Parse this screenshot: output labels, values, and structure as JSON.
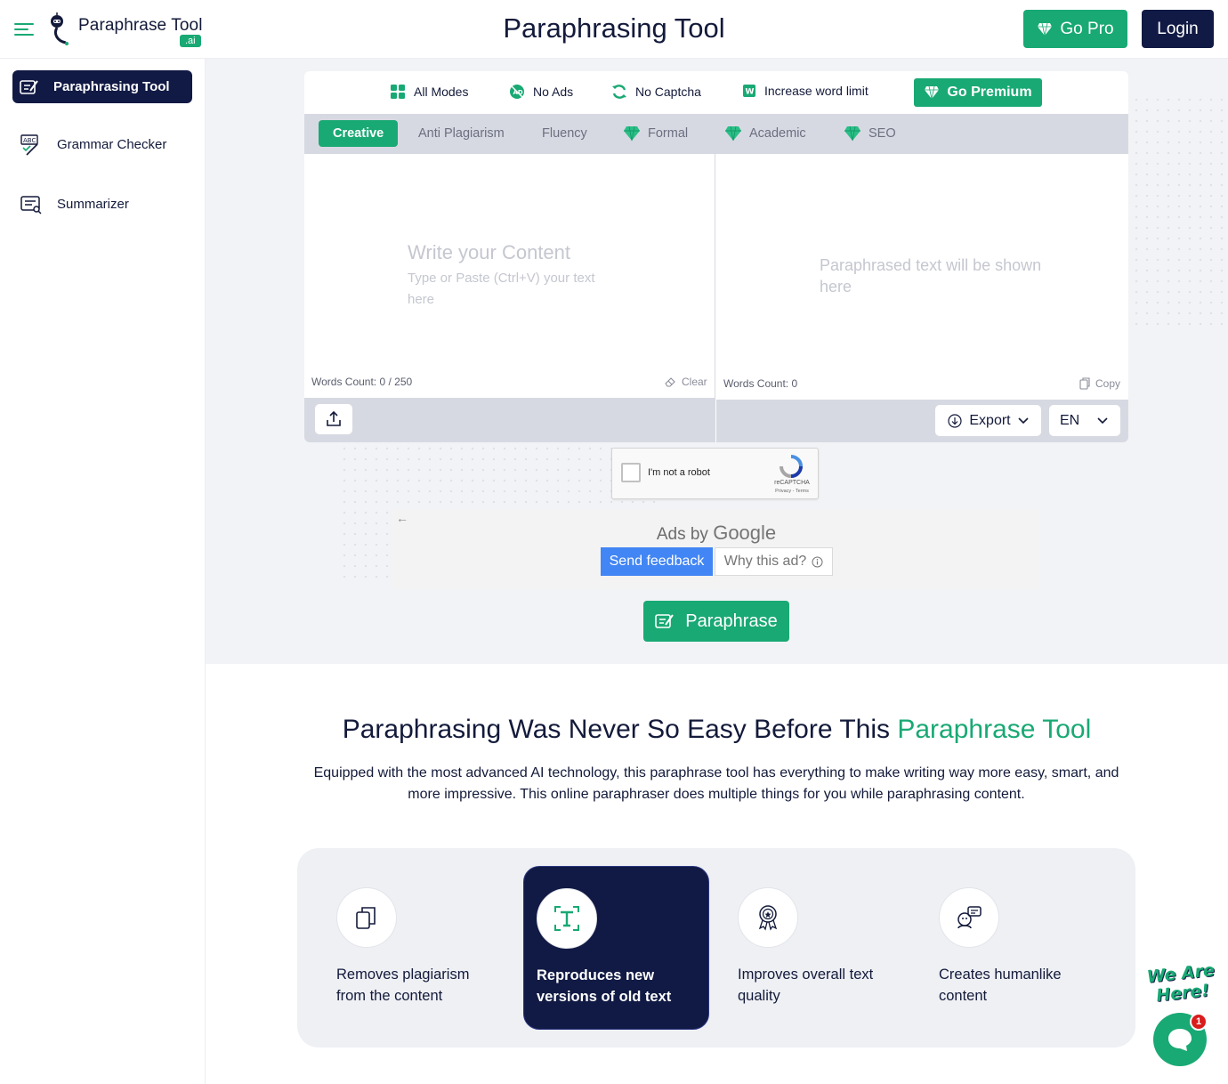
{
  "header": {
    "logo_text": "Paraphrase Tool",
    "logo_badge": ".ai",
    "title": "Paraphrasing Tool",
    "go_pro_label": "Go Pro",
    "login_label": "Login"
  },
  "sidebar": {
    "items": [
      {
        "label": "Paraphrasing Tool",
        "icon": "paraphrase-icon",
        "active": true
      },
      {
        "label": "Grammar Checker",
        "icon": "grammar-icon",
        "active": false
      },
      {
        "label": "Summarizer",
        "icon": "summarizer-icon",
        "active": false
      }
    ]
  },
  "features": {
    "items": [
      "All Modes",
      "No Ads",
      "No Captcha",
      "Increase word limit"
    ],
    "premium_label": "Go Premium"
  },
  "modes": {
    "items": [
      {
        "label": "Creative",
        "active": true,
        "premium": false
      },
      {
        "label": "Anti Plagiarism",
        "active": false,
        "premium": false
      },
      {
        "label": "Fluency",
        "active": false,
        "premium": false
      },
      {
        "label": "Formal",
        "active": false,
        "premium": true
      },
      {
        "label": "Academic",
        "active": false,
        "premium": true
      },
      {
        "label": "SEO",
        "active": false,
        "premium": true
      }
    ]
  },
  "input_pane": {
    "placeholder_title": "Write your Content",
    "placeholder_sub": "Type or Paste (Ctrl+V) your text here",
    "words_count": "Words Count: 0 / 250",
    "clear_label": "Clear"
  },
  "output_pane": {
    "placeholder": "Paraphrased text will be shown here",
    "words_count": "Words Count: 0",
    "copy_label": "Copy",
    "export_label": "Export",
    "language": "EN"
  },
  "captcha": {
    "label": "I'm not a robot",
    "brand": "reCAPTCHA",
    "terms": "Privacy - Terms"
  },
  "ads": {
    "title_prefix": "Ads by",
    "title_brand": "Google",
    "feedback_label": "Send feedback",
    "why_label": "Why this ad?"
  },
  "paraphrase_button": "Paraphrase",
  "section": {
    "title_main": "Paraphrasing Was Never So Easy Before This ",
    "title_highlight": "Paraphrase Tool",
    "description": "Equipped with the most advanced AI technology, this paraphrase tool has everything to make writing way more easy, smart, and more impressive. This online paraphraser does multiple things for you while paraphrasing content."
  },
  "cards": [
    {
      "text": "Removes plagiarism from the content",
      "icon": "copy-pages-icon",
      "highlighted": false
    },
    {
      "text": "Reproduces new versions of old text",
      "icon": "text-frame-icon",
      "highlighted": true
    },
    {
      "text": "Improves overall text quality",
      "icon": "award-badge-icon",
      "highlighted": false
    },
    {
      "text": "Creates humanlike content",
      "icon": "human-chat-icon",
      "highlighted": false
    }
  ],
  "chat": {
    "label": "We Are Here!",
    "unread_count": "1"
  },
  "colors": {
    "accent": "#19a974",
    "navy": "#111a44",
    "mode_bar": "#d7d9e2",
    "hero_bg": "#f2f3f6"
  }
}
